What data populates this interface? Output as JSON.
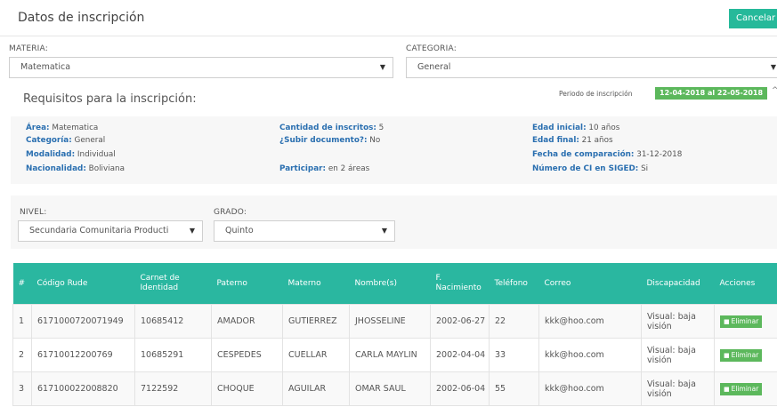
{
  "header": {
    "title": "Datos de inscripción",
    "cancel_label": "Cancelar"
  },
  "materia": {
    "label": "MATERIA:",
    "value": "Matematica"
  },
  "categoria": {
    "label": "CATEGORIA:",
    "value": "General"
  },
  "requisitos": {
    "title": "Requisitos para la inscripción:",
    "period_label": "Periodo de inscripción",
    "period_value": "12-04-2018 al 22-05-2018",
    "items": {
      "area": {
        "k": "Área:",
        "v": " Matematica"
      },
      "categoria": {
        "k": "Categoría:",
        "v": " General"
      },
      "modalidad": {
        "k": "Modalidad:",
        "v": " Individual"
      },
      "nacionalidad": {
        "k": "Nacionalidad:",
        "v": " Boliviana"
      },
      "inscritos": {
        "k": "Cantidad de inscritos:",
        "v": " 5"
      },
      "documento": {
        "k": "¿Subir documento?:",
        "v": " No"
      },
      "participar": {
        "k": "Participar:",
        "v": " en 2 áreas"
      },
      "edad_inicial": {
        "k": "Edad inicial:",
        "v": " 10 años"
      },
      "edad_final": {
        "k": "Edad final:",
        "v": " 21 años"
      },
      "fecha_comp": {
        "k": "Fecha de comparación:",
        "v": " 31-12-2018"
      },
      "ci_siged": {
        "k": "Número de CI en SIGED:",
        "v": " Si"
      }
    }
  },
  "nivel": {
    "label": "NIVEL:",
    "value": "Secundaria Comunitaria Producti"
  },
  "grado": {
    "label": "GRADO:",
    "value": "Quinto"
  },
  "table": {
    "headers": [
      "#",
      "Código Rude",
      "Carnet de Identidad",
      "Paterno",
      "Materno",
      "Nombre(s)",
      "F. Nacimiento",
      "Teléfono",
      "Correo",
      "Discapacidad",
      "Acciones"
    ],
    "rows": [
      [
        "1",
        "6171000720071949",
        "10685412",
        "AMADOR",
        "GUTIERREZ",
        "JHOSSELINE",
        "2002-06-27",
        "22",
        "kkk@hoo.com",
        "Visual: baja visión"
      ],
      [
        "2",
        "61710012200769",
        "10685291",
        "CESPEDES",
        "CUELLAR",
        "CARLA MAYLIN",
        "2002-04-04",
        "33",
        "kkk@hoo.com",
        "Visual: baja visión"
      ],
      [
        "3",
        "617100022008820",
        "7122592",
        "CHOQUE",
        "AGUILAR",
        "OMAR SAUL",
        "2002-06-04",
        "55",
        "kkk@hoo.com",
        "Visual: baja visión"
      ]
    ],
    "delete_label": "Eliminar"
  },
  "colors": {
    "accent": "#26b99a",
    "header_bg": "#2ab7a0",
    "badge": "#5cb85c",
    "key_text": "#2a6fb0"
  }
}
